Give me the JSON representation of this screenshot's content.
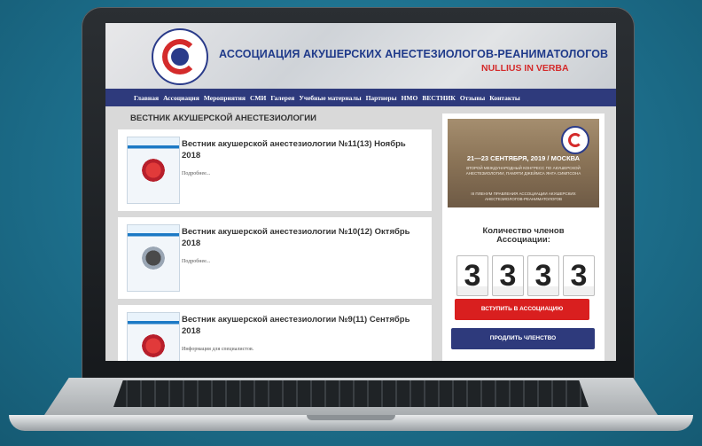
{
  "site": {
    "title": "АССОЦИАЦИЯ АКУШЕРСКИХ АНЕСТЕЗИОЛОГОВ-РЕАНИМАТОЛОГОВ",
    "motto": "NULLIUS IN VERBA"
  },
  "nav": {
    "items": [
      "Главная",
      "Ассоциация",
      "Мероприятия",
      "СМИ",
      "Галерея",
      "Учебные материалы",
      "Партнеры",
      "НМО",
      "ВЕСТНИК",
      "Отзывы",
      "Контакты"
    ]
  },
  "section": {
    "title": "ВЕСТНИК АКУШЕРСКОЙ АНЕСТЕЗИОЛОГИИ"
  },
  "articles": [
    {
      "title": "Вестник акушерской анестезиологии №11(13) Ноябрь 2018",
      "link": "Подробнее..."
    },
    {
      "title": "Вестник акушерской анестезиологии №10(12) Октябрь 2018",
      "link": "Подробнее..."
    },
    {
      "title": "Вестник акушерской анестезиологии №9(11) Сентябрь 2018",
      "link": "Информация для специалистов."
    }
  ],
  "sidebar": {
    "banner": {
      "date": "21—23 СЕНТЯБРЯ, 2019 / МОСКВА",
      "line1": "ВТОРОЙ МЕЖДУНАРОДНЫЙ КОНГРЕСС ПО АКУШЕРСКОЙ АНЕСТЕЗИОЛОГИИ, ПАМЯТИ ДЖЕЙМСА ЯНГА СИМПСОНА",
      "line2": "III ПЛЕНУМ ПРАВЛЕНИЯ АССОЦИАЦИИ АКУШЕРСКИХ АНЕСТЕЗИОЛОГОВ-РЕАНИМАТОЛОГОВ"
    },
    "members_label": "Количество членов Ассоциации:",
    "members_count_digits": [
      "3",
      "3",
      "3",
      "3"
    ],
    "join_button": "ВСТУПИТЬ В АССОЦИАЦИЮ",
    "renew_button": "ПРОДЛИТЬ ЧЛЕНСТВО"
  },
  "colors": {
    "brand_blue": "#2e3a7c",
    "accent_red": "#d91f1f",
    "background": "#1d6f8c"
  }
}
